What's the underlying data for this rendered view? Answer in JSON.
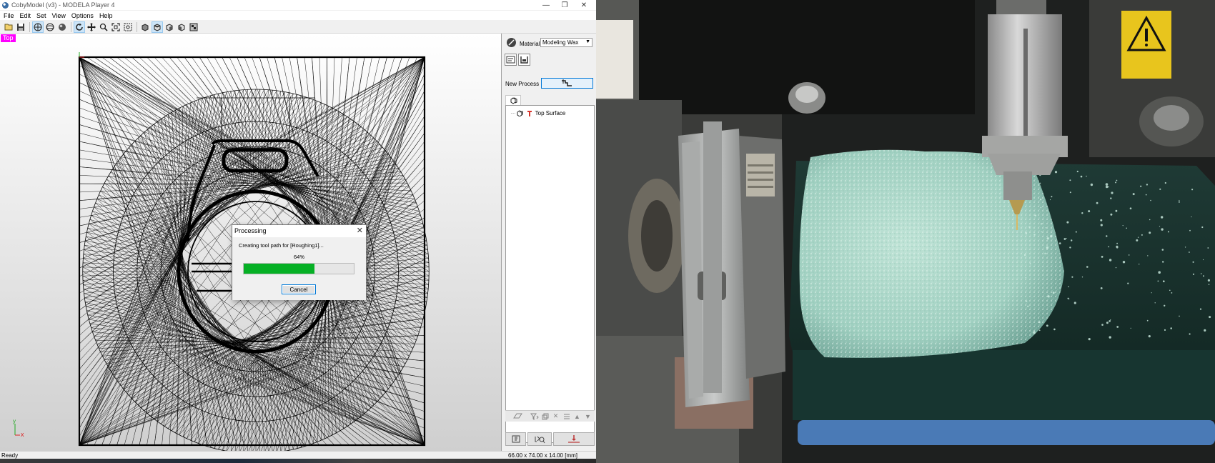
{
  "window": {
    "title": "CobyModel (v3) - MODELA Player 4",
    "controls": {
      "minimize": "—",
      "maximize": "❐",
      "close": "✕"
    }
  },
  "menu": [
    "File",
    "Edit",
    "Set",
    "View",
    "Options",
    "Help"
  ],
  "toolbar": {
    "icons": [
      "open-icon",
      "save-icon",
      "perspective-icon",
      "sphere-wire-icon",
      "shaded-sphere-icon",
      "rotate-icon",
      "pan-icon",
      "zoom-icon",
      "fit-icon",
      "zoom-box-icon",
      "view-front-icon",
      "view-top-icon",
      "view-right-icon",
      "view-left-icon",
      "view-iso-icon"
    ],
    "active": [
      "perspective-icon",
      "rotate-icon",
      "view-top-icon"
    ]
  },
  "viewport": {
    "view_label": "Top",
    "axis": {
      "y": "y",
      "x": "x"
    }
  },
  "dialog": {
    "title": "Processing",
    "message": "Creating tool path for [Roughing1]...",
    "progress_text": "64%",
    "progress": 0.64,
    "button": "Cancel",
    "close": "✕"
  },
  "sidepanel": {
    "material_label": "Material",
    "material_value": "Modeling Wax",
    "new_process_label": "New Process",
    "tree": {
      "item": "Top Surface"
    }
  },
  "statusbar": {
    "left": "Ready",
    "right": "66.00 x 74.00 x 14.00 [mm]"
  },
  "colors": {
    "view_label_bg": "#ff00ff",
    "progress_fill": "#06b025",
    "accent": "#0078d7"
  }
}
